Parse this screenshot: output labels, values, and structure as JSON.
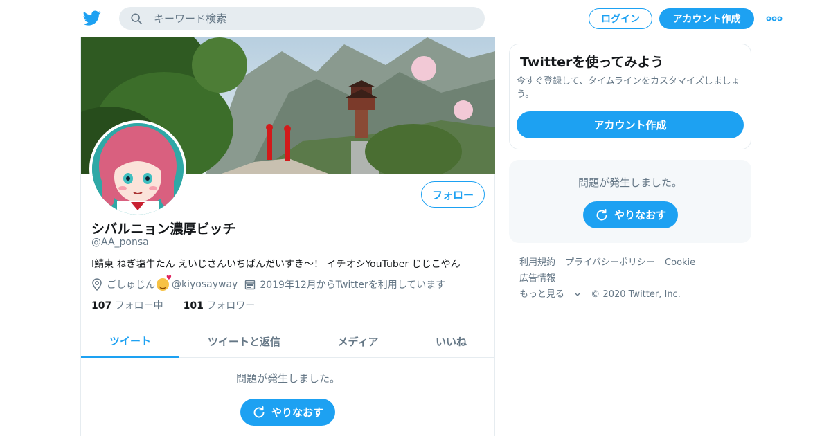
{
  "header": {
    "search_placeholder": "キーワード検索",
    "login_label": "ログイン",
    "signup_label": "アカウント作成",
    "icons": [
      "twitter-bird-icon",
      "search-icon",
      "more-dots-icon"
    ]
  },
  "profile": {
    "follow_label": "フォロー",
    "name": "シバルニョン濃厚ビッチ",
    "handle": "@AA_ponsa",
    "bio": "I鯖東 ねぎ塩牛たん えいじさんいちばんだいすき〜！ イチオシYouTuber じじこやん",
    "location": "ごしゅじん",
    "location_link": "@kiyosayway",
    "joined": "2019年12月からTwitterを利用しています",
    "following_count": "107",
    "following_label": "フォロー中",
    "followers_count": "101",
    "followers_label": "フォロワー"
  },
  "tabs": [
    {
      "label": "ツイート",
      "active": true
    },
    {
      "label": "ツイートと返信",
      "active": false
    },
    {
      "label": "メディア",
      "active": false
    },
    {
      "label": "いいね",
      "active": false
    }
  ],
  "timeline": {
    "error_text": "問題が発生しました。",
    "retry_label": "やりなおす"
  },
  "sidebar": {
    "card_title": "Twitterを使ってみよう",
    "card_desc": "今すぐ登録して、タイムラインをカスタマイズしましょう。",
    "card_button": "アカウント作成",
    "error_text": "問題が発生しました。",
    "retry_label": "やりなおす"
  },
  "footer": {
    "links": [
      "利用規約",
      "プライバシーポリシー",
      "Cookie",
      "広告情報",
      "もっと見る"
    ],
    "copyright": "© 2020 Twitter, Inc."
  },
  "colors": {
    "accent": "#1da1f2",
    "text": "#14171a",
    "muted": "#657786",
    "border": "#e6ecf0"
  }
}
